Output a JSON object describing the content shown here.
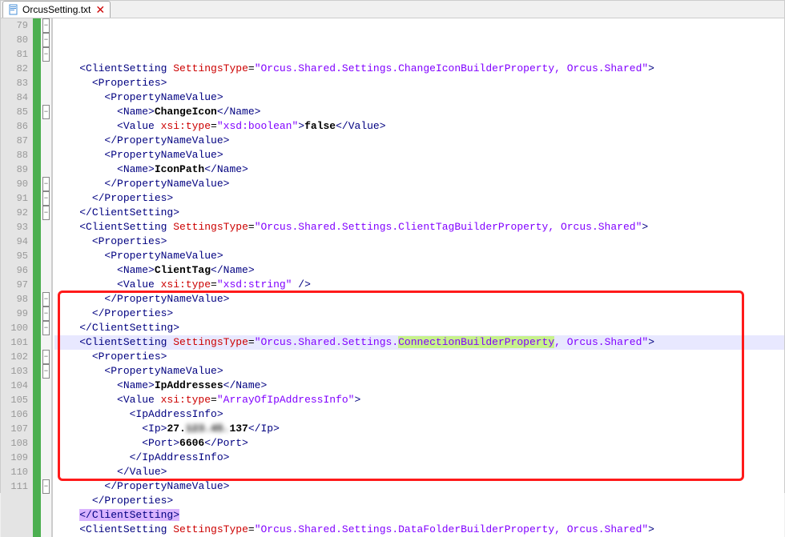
{
  "tab": {
    "filename": "OrcusSetting.txt"
  },
  "lines": [
    {
      "n": 79,
      "fold": "minus",
      "indent": 2,
      "parts": [
        {
          "k": "br",
          "t": "<"
        },
        {
          "k": "br",
          "t": "ClientSetting "
        },
        {
          "k": "at",
          "t": "SettingsType"
        },
        {
          "k": "eq",
          "t": "="
        },
        {
          "k": "st",
          "t": "\"Orcus.Shared.Settings.ChangeIconBuilderProperty, Orcus.Shared\""
        },
        {
          "k": "br",
          "t": ">"
        }
      ]
    },
    {
      "n": 80,
      "fold": "minus",
      "indent": 3,
      "parts": [
        {
          "k": "br",
          "t": "<Properties>"
        }
      ]
    },
    {
      "n": 81,
      "fold": "minus",
      "indent": 4,
      "parts": [
        {
          "k": "br",
          "t": "<PropertyNameValue>"
        }
      ]
    },
    {
      "n": 82,
      "fold": "",
      "indent": 5,
      "parts": [
        {
          "k": "br",
          "t": "<Name>"
        },
        {
          "k": "tx",
          "t": "ChangeIcon"
        },
        {
          "k": "br",
          "t": "</Name>"
        }
      ]
    },
    {
      "n": 83,
      "fold": "",
      "indent": 5,
      "parts": [
        {
          "k": "br",
          "t": "<Value "
        },
        {
          "k": "at",
          "t": "xsi:type"
        },
        {
          "k": "eq",
          "t": "="
        },
        {
          "k": "st",
          "t": "\"xsd:boolean\""
        },
        {
          "k": "br",
          "t": ">"
        },
        {
          "k": "tx",
          "t": "false"
        },
        {
          "k": "br",
          "t": "</Value>"
        }
      ]
    },
    {
      "n": 84,
      "fold": "",
      "indent": 4,
      "parts": [
        {
          "k": "br",
          "t": "</PropertyNameValue>"
        }
      ]
    },
    {
      "n": 85,
      "fold": "minus",
      "indent": 4,
      "parts": [
        {
          "k": "br",
          "t": "<PropertyNameValue>"
        }
      ]
    },
    {
      "n": 86,
      "fold": "",
      "indent": 5,
      "parts": [
        {
          "k": "br",
          "t": "<Name>"
        },
        {
          "k": "tx",
          "t": "IconPath"
        },
        {
          "k": "br",
          "t": "</Name>"
        }
      ]
    },
    {
      "n": 87,
      "fold": "",
      "indent": 4,
      "parts": [
        {
          "k": "br",
          "t": "</PropertyNameValue>"
        }
      ]
    },
    {
      "n": 88,
      "fold": "",
      "indent": 3,
      "parts": [
        {
          "k": "br",
          "t": "</Properties>"
        }
      ]
    },
    {
      "n": 89,
      "fold": "",
      "indent": 2,
      "parts": [
        {
          "k": "br",
          "t": "</ClientSetting>"
        }
      ]
    },
    {
      "n": 90,
      "fold": "minus",
      "indent": 2,
      "parts": [
        {
          "k": "br",
          "t": "<"
        },
        {
          "k": "br",
          "t": "ClientSetting "
        },
        {
          "k": "at",
          "t": "SettingsType"
        },
        {
          "k": "eq",
          "t": "="
        },
        {
          "k": "st",
          "t": "\"Orcus.Shared.Settings.ClientTagBuilderProperty, Orcus.Shared\""
        },
        {
          "k": "br",
          "t": ">"
        }
      ]
    },
    {
      "n": 91,
      "fold": "minus",
      "indent": 3,
      "parts": [
        {
          "k": "br",
          "t": "<Properties>"
        }
      ]
    },
    {
      "n": 92,
      "fold": "minus",
      "indent": 4,
      "parts": [
        {
          "k": "br",
          "t": "<PropertyNameValue>"
        }
      ]
    },
    {
      "n": 93,
      "fold": "",
      "indent": 5,
      "parts": [
        {
          "k": "br",
          "t": "<Name>"
        },
        {
          "k": "tx",
          "t": "ClientTag"
        },
        {
          "k": "br",
          "t": "</Name>"
        }
      ]
    },
    {
      "n": 94,
      "fold": "",
      "indent": 5,
      "parts": [
        {
          "k": "br",
          "t": "<Value "
        },
        {
          "k": "at",
          "t": "xsi:type"
        },
        {
          "k": "eq",
          "t": "="
        },
        {
          "k": "st",
          "t": "\"xsd:string\""
        },
        {
          "k": "br",
          "t": " />"
        }
      ]
    },
    {
      "n": 95,
      "fold": "",
      "indent": 4,
      "parts": [
        {
          "k": "br",
          "t": "</PropertyNameValue>"
        }
      ]
    },
    {
      "n": 96,
      "fold": "",
      "indent": 3,
      "parts": [
        {
          "k": "br",
          "t": "</Properties>"
        }
      ]
    },
    {
      "n": 97,
      "fold": "",
      "indent": 2,
      "parts": [
        {
          "k": "br",
          "t": "</ClientSetting>"
        }
      ]
    },
    {
      "n": 98,
      "fold": "minus",
      "hl": true,
      "indent": 2,
      "parts": [
        {
          "k": "br",
          "t": "<"
        },
        {
          "k": "br",
          "t": "ClientSetting "
        },
        {
          "k": "at",
          "t": "SettingsType"
        },
        {
          "k": "eq",
          "t": "="
        },
        {
          "k": "st",
          "t": "\"Orcus.Shared.Settings."
        },
        {
          "k": "hw",
          "t": "ConnectionBuilderProperty"
        },
        {
          "k": "st",
          "t": ", Orcus.Shared\""
        },
        {
          "k": "br",
          "t": ">"
        }
      ]
    },
    {
      "n": 99,
      "fold": "minus",
      "indent": 3,
      "parts": [
        {
          "k": "br",
          "t": "<Properties>"
        }
      ]
    },
    {
      "n": 100,
      "fold": "minus",
      "indent": 4,
      "parts": [
        {
          "k": "br",
          "t": "<PropertyNameValue>"
        }
      ]
    },
    {
      "n": 101,
      "fold": "",
      "indent": 5,
      "parts": [
        {
          "k": "br",
          "t": "<Name>"
        },
        {
          "k": "tx",
          "t": "IpAddresses"
        },
        {
          "k": "br",
          "t": "</Name>"
        }
      ]
    },
    {
      "n": 102,
      "fold": "minus",
      "indent": 5,
      "parts": [
        {
          "k": "br",
          "t": "<Value "
        },
        {
          "k": "at",
          "t": "xsi:type"
        },
        {
          "k": "eq",
          "t": "="
        },
        {
          "k": "st",
          "t": "\"ArrayOfIpAddressInfo\""
        },
        {
          "k": "br",
          "t": ">"
        }
      ]
    },
    {
      "n": 103,
      "fold": "minus",
      "indent": 6,
      "parts": [
        {
          "k": "br",
          "t": "<IpAddressInfo>"
        }
      ]
    },
    {
      "n": 104,
      "fold": "",
      "indent": 7,
      "parts": [
        {
          "k": "br",
          "t": "<Ip>"
        },
        {
          "k": "tx",
          "t": "27."
        },
        {
          "k": "blur",
          "t": "123.45."
        },
        {
          "k": "tx",
          "t": "137"
        },
        {
          "k": "br",
          "t": "</Ip>"
        }
      ]
    },
    {
      "n": 105,
      "fold": "",
      "indent": 7,
      "parts": [
        {
          "k": "br",
          "t": "<Port>"
        },
        {
          "k": "tx",
          "t": "6606"
        },
        {
          "k": "br",
          "t": "</Port>"
        }
      ]
    },
    {
      "n": 106,
      "fold": "",
      "indent": 6,
      "parts": [
        {
          "k": "br",
          "t": "</IpAddressInfo>"
        }
      ]
    },
    {
      "n": 107,
      "fold": "",
      "indent": 5,
      "parts": [
        {
          "k": "br",
          "t": "</Value>"
        }
      ]
    },
    {
      "n": 108,
      "fold": "",
      "indent": 4,
      "parts": [
        {
          "k": "br",
          "t": "</PropertyNameValue>"
        }
      ]
    },
    {
      "n": 109,
      "fold": "",
      "indent": 3,
      "parts": [
        {
          "k": "br",
          "t": "</Properties>"
        }
      ]
    },
    {
      "n": 110,
      "fold": "",
      "indent": 2,
      "parts": [
        {
          "k": "hc",
          "t": "</ClientSetting>"
        }
      ]
    },
    {
      "n": 111,
      "fold": "minus",
      "indent": 2,
      "parts": [
        {
          "k": "br",
          "t": "<"
        },
        {
          "k": "br",
          "t": "ClientSetting "
        },
        {
          "k": "at",
          "t": "SettingsType"
        },
        {
          "k": "eq",
          "t": "="
        },
        {
          "k": "st",
          "t": "\"Orcus.Shared.Settings.DataFolderBuilderProperty, Orcus.Shared\""
        },
        {
          "k": "br",
          "t": ">"
        }
      ]
    }
  ],
  "highlight_box": {
    "top_line": 98,
    "bottom_line": 110
  }
}
